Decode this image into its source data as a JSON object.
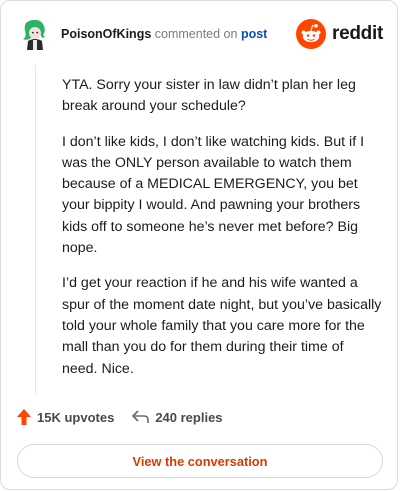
{
  "comment": {
    "username": "PoisonOfKings",
    "action": "commented on",
    "target": "post",
    "paragraphs": [
      "YTA. Sorry your sister in law didn’t plan her leg break around your schedule?",
      "I don’t like kids, I don’t like watching kids. But if I was the ONLY person available to watch them because of a MEDICAL EMERGENCY, you bet your bippity I would. And pawning your brothers kids off to someone he’s never met before? Big nope.",
      "I’d get your reaction if he and his wife wanted a spur of the moment date night, but you’ve basically told your whole family that you care more for the mall than you do for them during their time of need. Nice."
    ]
  },
  "brand": {
    "name": "reddit",
    "color": "#ff4500"
  },
  "stats": {
    "upvotes": "15K upvotes",
    "replies": "240 replies"
  },
  "cta": {
    "label": "View the conversation"
  },
  "colors": {
    "accent": "#d93a00",
    "link": "#0a4fb0",
    "upvote": "#ff4500"
  }
}
